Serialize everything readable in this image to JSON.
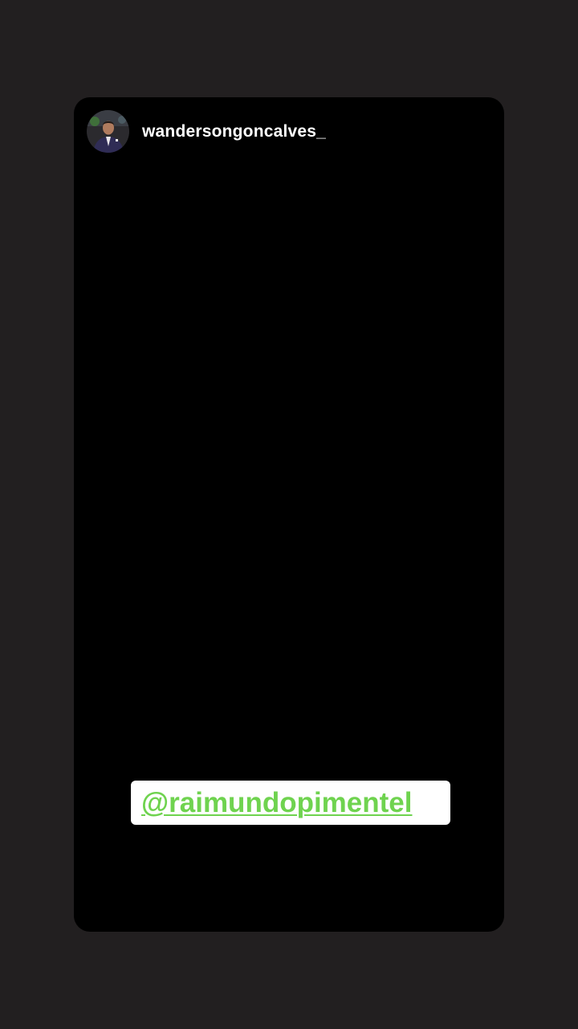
{
  "story": {
    "username": "wandersongoncalves_",
    "avatar_icon": "profile-avatar",
    "mention": "@raimundopimentel"
  },
  "colors": {
    "page_background": "#221f20",
    "story_background": "#000000",
    "mention_text": "#6fd34f",
    "mention_sticker_background": "#ffffff"
  }
}
